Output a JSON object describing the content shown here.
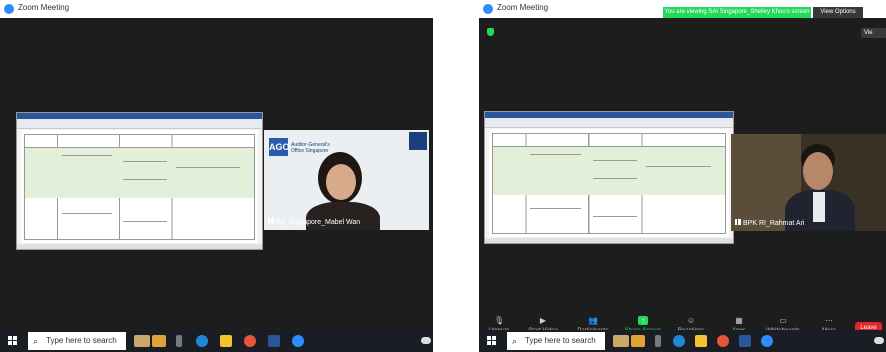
{
  "left": {
    "window_title": "Zoom Meeting",
    "tile_label": "EA_Singapore_Mabel Wan",
    "logo": {
      "mark": "AGO",
      "org_name": "Auditor-General's Office Singapore"
    },
    "taskbar_search": "Type here to search"
  },
  "right": {
    "window_title": "Zoom Meeting",
    "share_banner": "You are viewing SAI Singapore_Shelley Khoo's screen",
    "view_options": "View Options",
    "view_button": "Vie",
    "tile_label": "BPK RI_Rahmat Ari",
    "controls": [
      {
        "label": "Unmute",
        "icon": "microphone-icon"
      },
      {
        "label": "Start Video",
        "icon": "video-icon"
      },
      {
        "label": "Participants",
        "icon": "participants-icon"
      },
      {
        "label": "Share Screen",
        "icon": "share-screen-icon"
      },
      {
        "label": "Reactions",
        "icon": "reactions-icon"
      },
      {
        "label": "Apps",
        "icon": "apps-icon"
      },
      {
        "label": "Whiteboards",
        "icon": "whiteboard-icon"
      },
      {
        "label": "More",
        "icon": "more-icon"
      }
    ],
    "leave_label": "Leave",
    "taskbar_search": "Type here to search"
  },
  "colors": {
    "share_green": "#23d959",
    "leave_red": "#e02828",
    "zoom_blue": "#2d8cff",
    "doc_green": "#e2efd9"
  }
}
